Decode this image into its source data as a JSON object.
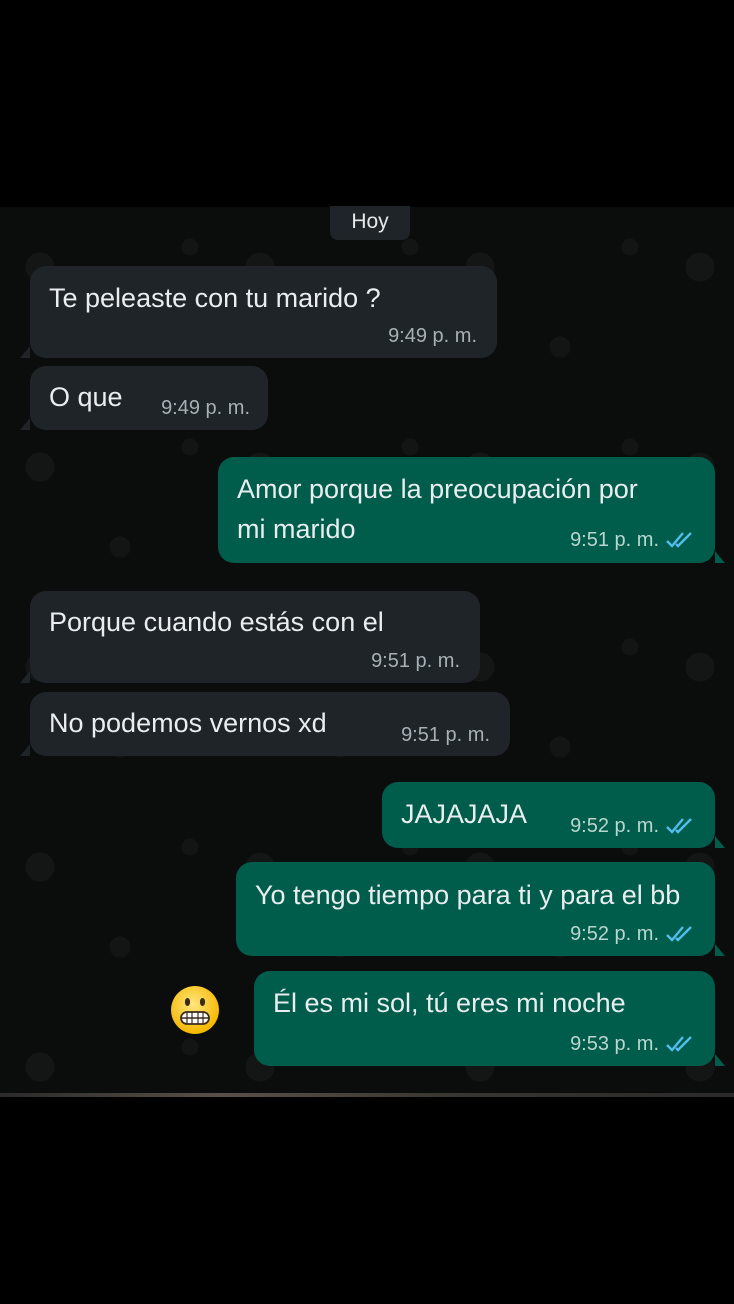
{
  "chat": {
    "date_label": "Hoy",
    "messages": [
      {
        "direction": "incoming",
        "text": "Te peleaste con tu marido ?",
        "time": "9:49 p. m."
      },
      {
        "direction": "incoming",
        "text": "O que",
        "time": "9:49 p. m."
      },
      {
        "direction": "outgoing",
        "text_line1": "Amor porque la preocupación por",
        "text_line2": "mi marido",
        "time": "9:51 p. m.",
        "status": "read"
      },
      {
        "direction": "incoming",
        "text": "Porque cuando estás con el",
        "time": "9:51 p. m."
      },
      {
        "direction": "incoming",
        "text": "No podemos vernos xd",
        "time": "9:51 p. m."
      },
      {
        "direction": "outgoing",
        "text": "JAJAJAJA",
        "time": "9:52 p. m.",
        "status": "read"
      },
      {
        "direction": "outgoing",
        "text": "Yo tengo tiempo para ti y para el bb",
        "time": "9:52 p. m.",
        "status": "read"
      },
      {
        "direction": "outgoing",
        "text": "Él es mi sol, tú eres mi noche",
        "time": "9:53 p. m.",
        "status": "read"
      }
    ],
    "overlay_emoji": "grimacing-face-emoji"
  },
  "colors": {
    "background": "#0b0c0c",
    "incoming_bubble": "#1f2428",
    "outgoing_bubble": "#005c4b",
    "read_ticks": "#53bdeb",
    "text": "#e9edef"
  }
}
